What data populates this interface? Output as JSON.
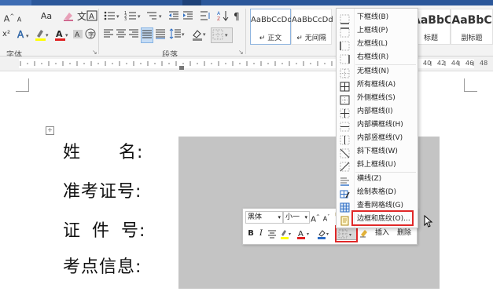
{
  "ribbon": {
    "font_size_label": "A",
    "clear_format_label": "Aa",
    "font_group_label": "字体",
    "paragraph_group_label": "段落",
    "styles": [
      {
        "sample": "AaBbCcDd",
        "name": "↵ 正文"
      },
      {
        "sample": "AaBbCcDd",
        "name": "↵ 无间隔"
      },
      {
        "sample": "AaBbC",
        "name": "标题"
      },
      {
        "sample": "AaBbC",
        "name": "副标题"
      }
    ]
  },
  "ruler": {
    "numbers_right": [
      "40",
      "42",
      "44",
      "46",
      "48"
    ]
  },
  "document": {
    "fields": [
      "姓  名:",
      "准考证号:",
      "证 件 号:",
      "考点信息:"
    ]
  },
  "mini_toolbar": {
    "font_name": "黑体",
    "font_size": "小一",
    "bold": "B",
    "italic": "I",
    "insert_label": "插入",
    "delete_label": "删除"
  },
  "border_menu": {
    "items": [
      {
        "label": "下框线(B)",
        "icon": "border-bottom-icon"
      },
      {
        "label": "上框线(P)",
        "icon": "border-top-icon"
      },
      {
        "label": "左框线(L)",
        "icon": "border-left-icon"
      },
      {
        "label": "右框线(R)",
        "icon": "border-right-icon"
      },
      {
        "label": "无框线(N)",
        "icon": "border-none-icon"
      },
      {
        "label": "所有框线(A)",
        "icon": "border-all-icon"
      },
      {
        "label": "外侧框线(S)",
        "icon": "border-outside-icon"
      },
      {
        "label": "内部框线(I)",
        "icon": "border-inside-icon"
      },
      {
        "label": "内部横框线(H)",
        "icon": "border-inside-horizontal-icon"
      },
      {
        "label": "内部竖框线(V)",
        "icon": "border-inside-vertical-icon"
      },
      {
        "label": "斜下框线(W)",
        "icon": "diagonal-down-icon"
      },
      {
        "label": "斜上框线(U)",
        "icon": "diagonal-up-icon"
      },
      {
        "label": "横线(Z)",
        "icon": "horizontal-line-icon"
      },
      {
        "label": "绘制表格(D)",
        "icon": "draw-table-icon"
      },
      {
        "label": "查看网格线(G)",
        "icon": "view-gridlines-icon"
      },
      {
        "label": "边框和底纹(O)...",
        "icon": "borders-shading-icon"
      }
    ]
  },
  "colors": {
    "highlight_red": "#e02828",
    "ribbon_blue": "#2b579a",
    "table_fill": "#c4c4c4"
  }
}
